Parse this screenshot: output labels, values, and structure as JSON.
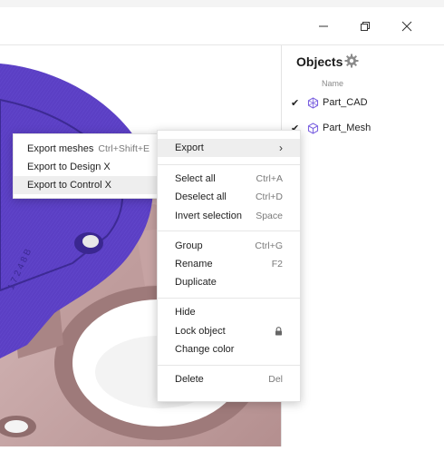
{
  "window": {
    "minimize_icon": "minimize-icon",
    "maximize_icon": "restore-icon",
    "close_icon": "close-icon"
  },
  "objects_panel": {
    "title": "Objects",
    "settings_icon": "gear-icon",
    "column_header": "Name",
    "items": [
      {
        "label": "Part_CAD",
        "checked": true,
        "icon": "cad-part-icon"
      },
      {
        "label": "Part_Mesh",
        "checked": true,
        "icon": "mesh-part-icon"
      }
    ]
  },
  "context_menu": {
    "export": {
      "label": "Export",
      "submenu_arrow": "›"
    },
    "select_all": {
      "label": "Select all",
      "shortcut": "Ctrl+A"
    },
    "deselect_all": {
      "label": "Deselect all",
      "shortcut": "Ctrl+D"
    },
    "invert_selection": {
      "label": "Invert selection",
      "shortcut": "Space"
    },
    "group": {
      "label": "Group",
      "shortcut": "Ctrl+G"
    },
    "rename": {
      "label": "Rename",
      "shortcut": "F2"
    },
    "duplicate": {
      "label": "Duplicate"
    },
    "hide": {
      "label": "Hide"
    },
    "lock_object": {
      "label": "Lock object",
      "icon": "lock-icon"
    },
    "change_color": {
      "label": "Change color"
    },
    "delete": {
      "label": "Delete",
      "shortcut": "Del"
    }
  },
  "export_submenu": {
    "export_meshes": {
      "label": "Export meshes",
      "shortcut": "Ctrl+Shift+E"
    },
    "export_design_x": {
      "label": "Export to Design X"
    },
    "export_control_x": {
      "label": "Export to Control X"
    }
  },
  "colors": {
    "cad_purple": "#5b3fc4",
    "mesh_pink": "#c9a8a8",
    "highlight": "#eeeeee",
    "accent_icon": "#7b61e0"
  }
}
